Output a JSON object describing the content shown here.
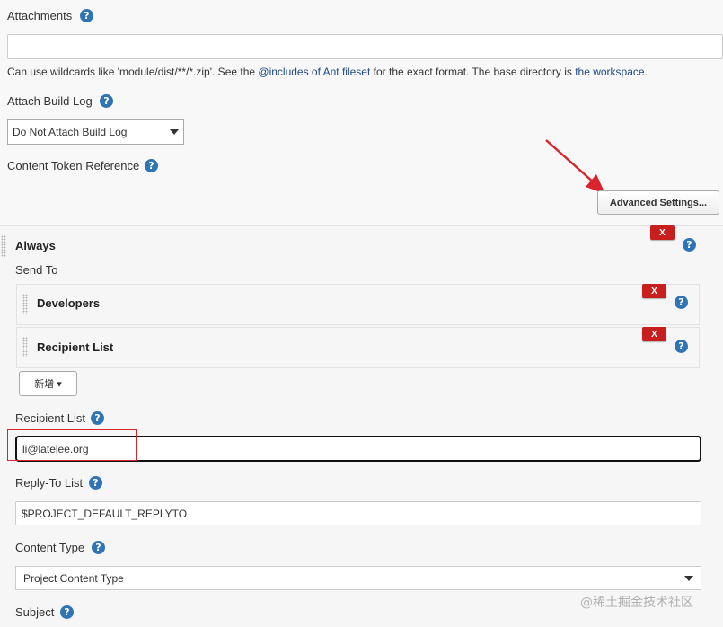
{
  "attachments": {
    "label": "Attachments",
    "value": "",
    "help_prefix": "Can use wildcards like 'module/dist/**/*.zip'. See the ",
    "help_link1": "@includes of Ant fileset",
    "help_middle": " for the exact format. The base directory is ",
    "help_link2": "the workspace",
    "help_suffix": "."
  },
  "attach_build_log": {
    "label": "Attach Build Log",
    "selected": "Do Not Attach Build Log"
  },
  "content_token_reference": {
    "label": "Content Token Reference"
  },
  "advanced_settings": {
    "label": "Advanced Settings..."
  },
  "trigger": {
    "title": "Always",
    "delete_label": "X",
    "send_to_label": "Send To",
    "send_to_items": [
      {
        "label": "Developers",
        "delete_label": "X"
      },
      {
        "label": "Recipient List",
        "delete_label": "X"
      }
    ],
    "add_button": "新增 ▾",
    "recipient_list": {
      "label": "Recipient List",
      "value": "li@latelee.org"
    },
    "reply_to_list": {
      "label": "Reply-To List",
      "value": "$PROJECT_DEFAULT_REPLYTO"
    },
    "content_type": {
      "label": "Content Type",
      "selected": "Project Content Type"
    },
    "subject": {
      "label": "Subject"
    }
  },
  "help_glyph": "?",
  "watermark": "@稀土掘金技术社区",
  "colors": {
    "accent_help": "#2f74b5",
    "delete_red": "#c81e1e",
    "annotation_red": "#d9232d"
  }
}
